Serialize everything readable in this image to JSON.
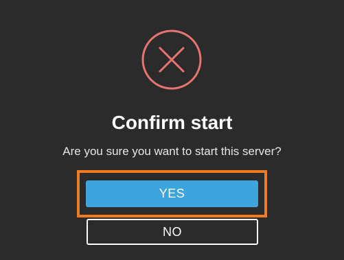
{
  "dialog": {
    "icon": "close-circle-icon",
    "icon_color": "#e87472",
    "title": "Confirm start",
    "message": "Are you sure you want to start this server?"
  },
  "buttons": {
    "yes_label": "YES",
    "no_label": "NO"
  },
  "colors": {
    "background": "#2b2b2b",
    "primary": "#3ea4dd",
    "focus_outline": "#f47b20",
    "text": "#ffffff"
  }
}
